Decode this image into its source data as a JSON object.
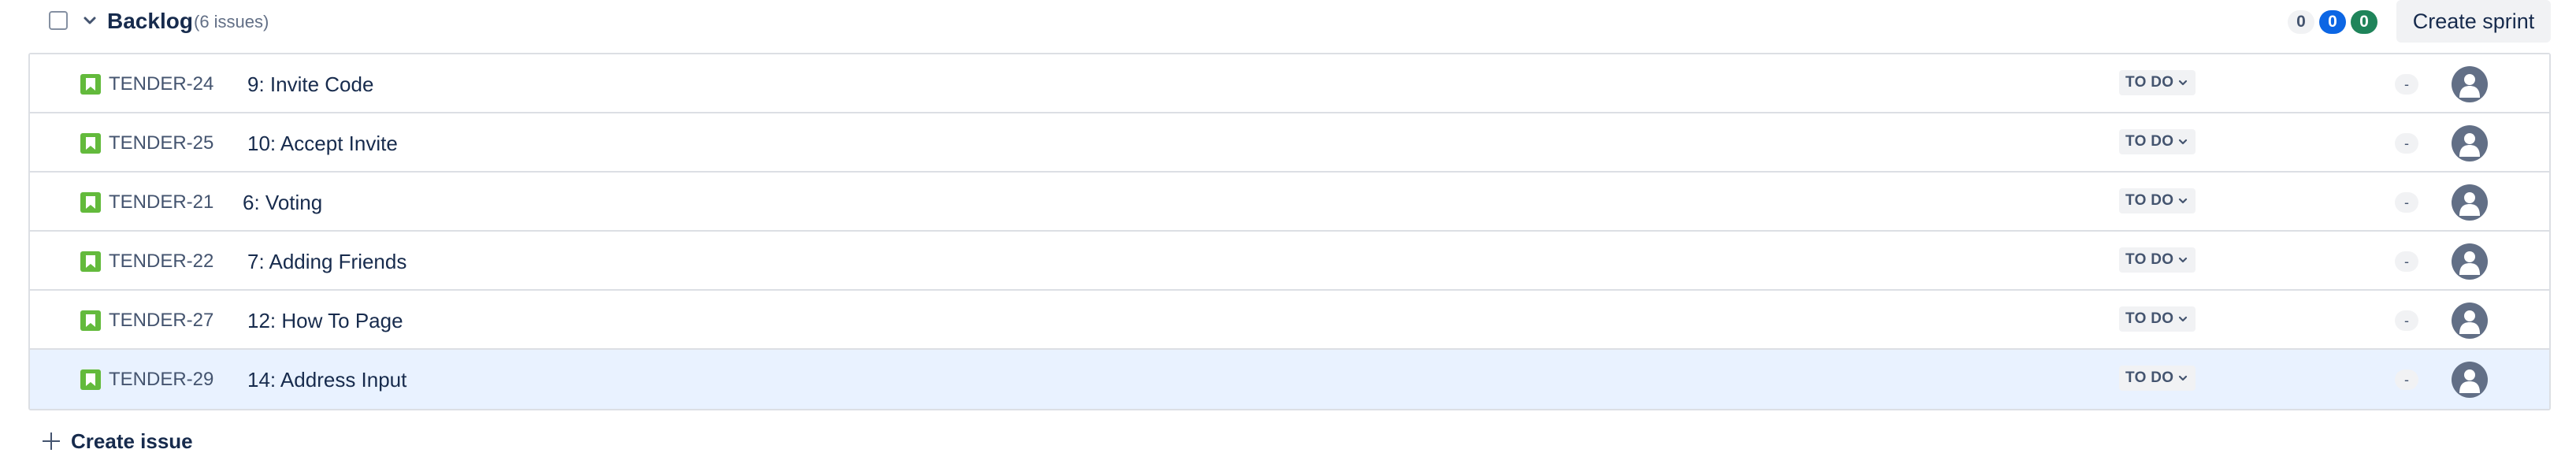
{
  "backlog": {
    "title": "Backlog",
    "issue_count": "(6 issues)",
    "counts": {
      "todo": "0",
      "in_progress": "0",
      "done": "0"
    },
    "create_sprint_label": "Create sprint",
    "create_issue_label": "Create issue"
  },
  "issues": [
    {
      "key": "TENDER-24",
      "summary": "9: Invite Code",
      "status": "TO DO",
      "estimate": "-",
      "type_icon": "story-icon",
      "selected": false
    },
    {
      "key": "TENDER-25",
      "summary": "10: Accept Invite",
      "status": "TO DO",
      "estimate": "-",
      "type_icon": "story-icon",
      "selected": false
    },
    {
      "key": "TENDER-21",
      "summary": "6: Voting",
      "status": "TO DO",
      "estimate": "-",
      "type_icon": "story-icon",
      "selected": false
    },
    {
      "key": "TENDER-22",
      "summary": "7: Adding Friends",
      "status": "TO DO",
      "estimate": "-",
      "type_icon": "story-icon",
      "selected": false
    },
    {
      "key": "TENDER-27",
      "summary": "12: How To Page",
      "status": "TO DO",
      "estimate": "-",
      "type_icon": "story-icon",
      "selected": false
    },
    {
      "key": "TENDER-29",
      "summary": "14: Address Input",
      "status": "TO DO",
      "estimate": "-",
      "type_icon": "story-icon",
      "selected": true
    }
  ],
  "colors": {
    "story_green": "#63ba3c",
    "selected_row": "#e9f2ff",
    "count_blue": "#0c66e4",
    "count_green": "#1f845a"
  }
}
